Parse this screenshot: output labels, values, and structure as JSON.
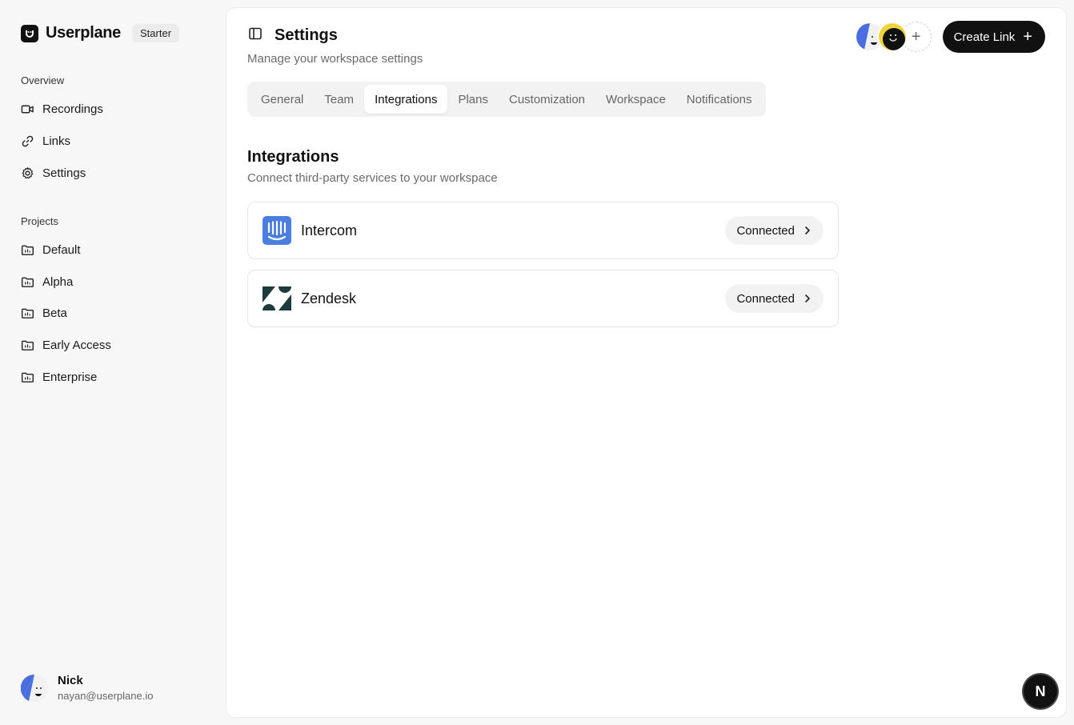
{
  "brand": {
    "name": "Userplane",
    "plan": "Starter"
  },
  "sidebar": {
    "overview_label": "Overview",
    "overview_items": [
      {
        "label": "Recordings",
        "icon": "video-icon"
      },
      {
        "label": "Links",
        "icon": "link-icon"
      },
      {
        "label": "Settings",
        "icon": "gear-icon"
      }
    ],
    "projects_label": "Projects",
    "project_items": [
      {
        "label": "Default",
        "icon": "folder-icon"
      },
      {
        "label": "Alpha",
        "icon": "folder-icon"
      },
      {
        "label": "Beta",
        "icon": "folder-icon"
      },
      {
        "label": "Early Access",
        "icon": "folder-icon"
      },
      {
        "label": "Enterprise",
        "icon": "folder-icon"
      }
    ]
  },
  "user": {
    "name": "Nick",
    "email": "nayan@userplane.io"
  },
  "header": {
    "title": "Settings",
    "subtitle": "Manage your workspace settings",
    "create_label": "Create Link"
  },
  "tabs": [
    {
      "label": "General",
      "active": false
    },
    {
      "label": "Team",
      "active": false
    },
    {
      "label": "Integrations",
      "active": true
    },
    {
      "label": "Plans",
      "active": false
    },
    {
      "label": "Customization",
      "active": false
    },
    {
      "label": "Workspace",
      "active": false
    },
    {
      "label": "Notifications",
      "active": false
    }
  ],
  "integrations": {
    "title": "Integrations",
    "subtitle": "Connect third-party services to your workspace",
    "items": [
      {
        "name": "Intercom",
        "status": "Connected",
        "color": "#4a7ee0"
      },
      {
        "name": "Zendesk",
        "status": "Connected",
        "color": "#1f3a3d"
      }
    ]
  },
  "dev_badge": {
    "label": "N"
  },
  "colors": {
    "accent": "#111111",
    "muted": "#6b6b6b",
    "tab_bg": "#f2f2f2",
    "avatar_blue": "#4a6ee0",
    "avatar_yellow": "#f0d23a"
  }
}
